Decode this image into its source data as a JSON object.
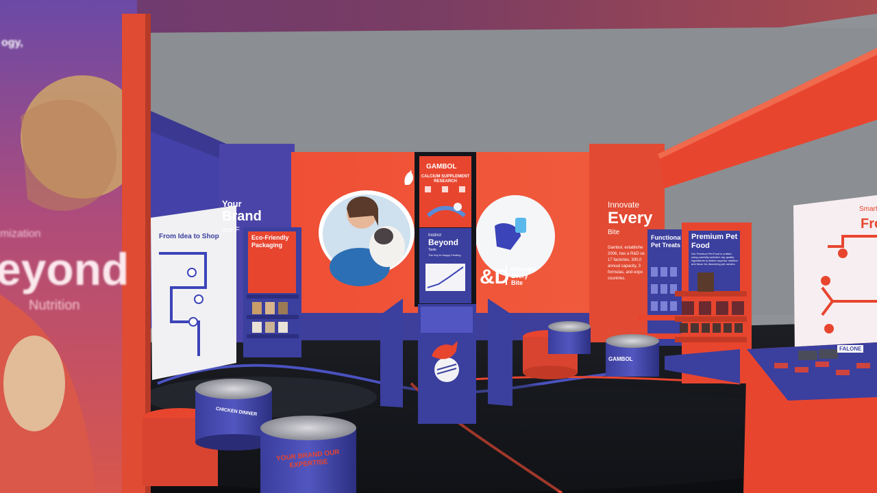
{
  "colors": {
    "brand_red": "#e8452f",
    "brand_orange": "#ef5a3a",
    "brand_navy": "#3b3f9e",
    "brand_purple": "#4a3f9a",
    "floor": "#121418",
    "wall_gray": "#8f9296",
    "panel_white": "#f2f2f4"
  },
  "left_banner": {
    "top_text": "ogy,",
    "line1": "mization",
    "headline": "eyond",
    "line3": "Nutrition"
  },
  "back_wall": {
    "left_panel": {
      "line1": "Your",
      "line2": "Brand",
      "line3": "our F"
    },
    "logo_mark": "cat-logo-icon",
    "screen_text": "&D",
    "screen_tagline": [
      "Innovate",
      "Every",
      "Bite"
    ],
    "right_panel": {
      "line1": "Innovate",
      "line2": "Every",
      "line3": "Bite",
      "paragraph": "Gambol, establishe 2006, has a R&D ce 17 factories, 300,0 annual capacity, 3 formulas, and expo countries."
    }
  },
  "totem": {
    "brand": "GAMBOL",
    "title": "CALCIUM SUPPLEMENT RESEARCH",
    "card_title_small": "Instinct",
    "card_title": "Beyond",
    "card_subtitle": "Taste",
    "card_caption": "The Key to Happy Feeding",
    "counter_icon": "cat-logo-icon"
  },
  "left_board": {
    "title": "From Idea to Shop"
  },
  "eco_shelf": {
    "title": "Eco-Friendly Packaging"
  },
  "premium_shelf": {
    "title": "Premium Pet Food",
    "desc": "Our Premium Pet Food is crafted using carefully selected, top-quality ingredients to deliver superior nutrition and flavor for discerning pet owners."
  },
  "functional_shelf": {
    "title": "Functional Pet Treats"
  },
  "right_board": {
    "line1": "Smart F",
    "line2": "Fron"
  },
  "cans": {
    "front_left_label": "CHICKEN DINNER",
    "front_center_label": "YOUR BRAND OUR EXPERTISE",
    "right_can_brand": "GAMBOL"
  },
  "table_sign": "FALONE"
}
